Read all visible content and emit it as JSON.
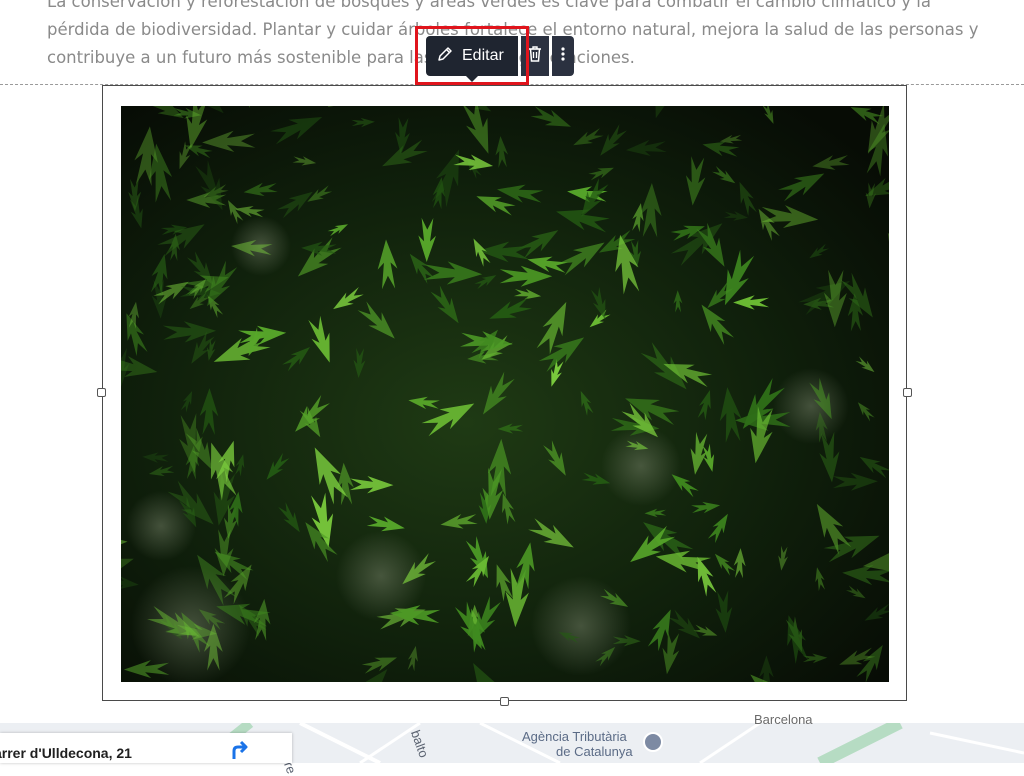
{
  "content": {
    "paragraph_lines": [
      "La conservación y reforestación de bosques y áreas verdes es clave para combatir el cambio climático y la",
      "pérdida de biodiversidad. Plantar y cuidar árboles fortalece el entorno natural, mejora la salud de las personas y",
      "contribuye a un futuro más sostenible para las próximas generaciones."
    ]
  },
  "toolbar": {
    "edit_label": "Editar",
    "edit_icon": "pencil-icon",
    "delete_icon": "trash-icon",
    "more_icon": "more-vertical-icon"
  },
  "image": {
    "subject_icon": "green-maple-leaves-photo"
  },
  "map": {
    "card_title": "arrer d'Ulldecona, 21",
    "card_icon": "directions-icon",
    "labels": [
      "Carre",
      "balto",
      "Agència Tributària",
      "de Catalunya",
      "Barcelona"
    ]
  },
  "colors": {
    "toolbar_bg": "#1f2530",
    "highlight": "#e0141c",
    "text_gray": "#8a8a8a"
  }
}
